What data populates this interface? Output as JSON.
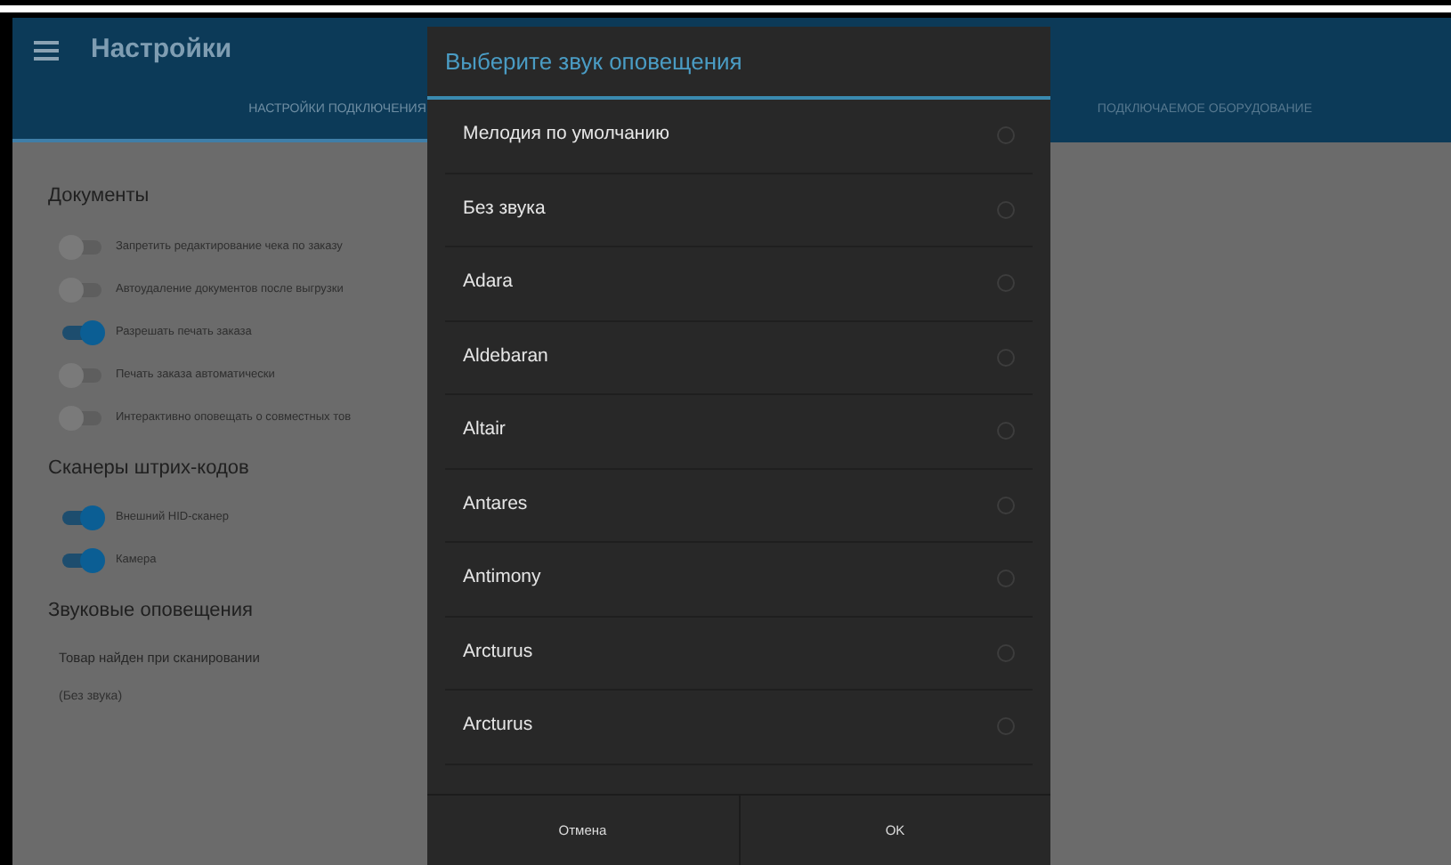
{
  "app_bar": {
    "title": "Настройки"
  },
  "tabs": [
    {
      "label": "НАСТРОЙКИ ПОДКЛЮЧЕНИЯ",
      "selected": true
    },
    {
      "label": "ПОДКЛЮЧАЕМОЕ ОБОРУДОВАНИЕ",
      "selected": false
    }
  ],
  "sections": [
    {
      "title": "Документы",
      "items": [
        {
          "kind": "switch",
          "label": "Запретить редактирование чека по заказу",
          "on": false
        },
        {
          "kind": "switch",
          "label": "Автоудаление документов после выгрузки",
          "on": false
        },
        {
          "kind": "switch",
          "label": "Разрешать печать заказа",
          "on": true
        },
        {
          "kind": "switch",
          "label": "Печать заказа автоматически",
          "on": false
        },
        {
          "kind": "switch",
          "label": "Интерактивно оповещать о совместных тов",
          "on": false
        }
      ]
    },
    {
      "title": "Сканеры штрих-кодов",
      "items": [
        {
          "kind": "switch",
          "label": "Внешний HID-сканер",
          "on": true
        },
        {
          "kind": "switch",
          "label": "Камера",
          "on": true
        }
      ]
    },
    {
      "title": "Звуковые оповещения",
      "items": [
        {
          "kind": "pref",
          "label": "Товар найден при сканировании",
          "value": "(Без звука)"
        }
      ]
    }
  ],
  "dialog": {
    "title": "Выберите звук оповещения",
    "options": [
      {
        "label": "Мелодия по умолчанию",
        "selected": false
      },
      {
        "label": "Без звука",
        "selected": false
      },
      {
        "label": "Adara",
        "selected": false
      },
      {
        "label": "Aldebaran",
        "selected": false
      },
      {
        "label": "Altair",
        "selected": false
      },
      {
        "label": "Antares",
        "selected": false
      },
      {
        "label": "Antimony",
        "selected": false
      },
      {
        "label": "Arcturus",
        "selected": false
      },
      {
        "label": "Arcturus",
        "selected": false
      }
    ],
    "buttons": [
      "Отмена",
      "OK"
    ]
  }
}
